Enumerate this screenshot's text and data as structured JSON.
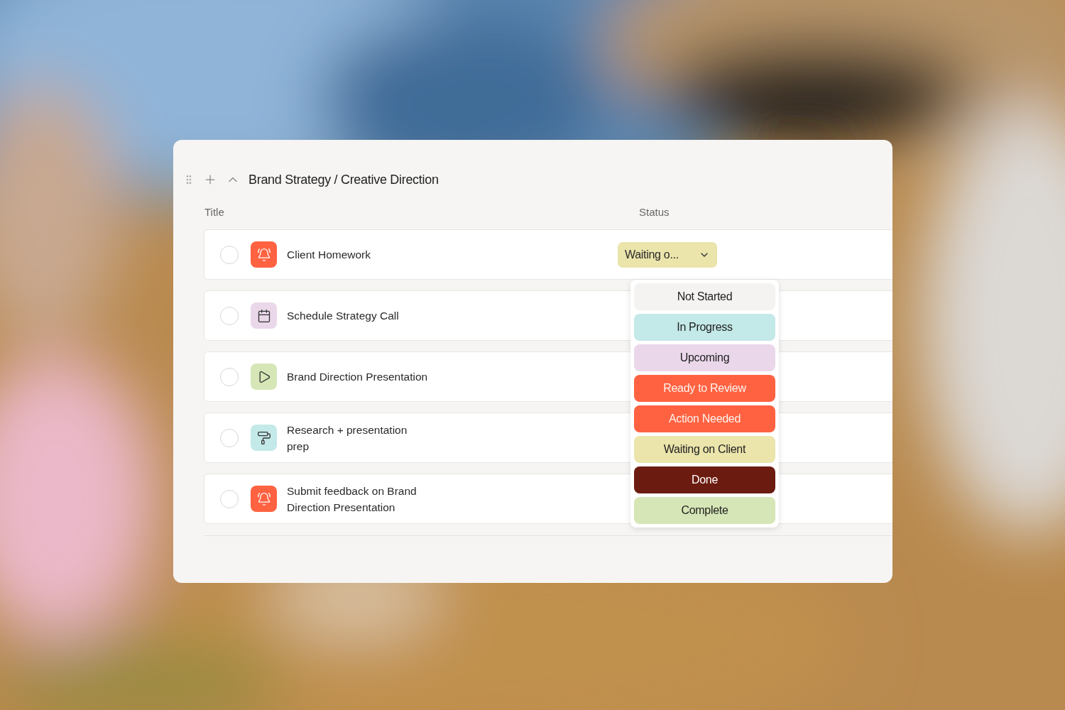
{
  "group": {
    "title": "Brand Strategy / Creative Direction",
    "expanded": true
  },
  "columns": [
    "Title",
    "Status"
  ],
  "tasks": [
    {
      "title": "Client Homework",
      "kind": "alarm",
      "color": "#ff6241",
      "checked": false,
      "status": {
        "label": "Waiting o...",
        "color": "#ebe4ab"
      }
    },
    {
      "title": "Schedule Strategy Call",
      "kind": "calendar",
      "color": "#ead8ea",
      "checked": false
    },
    {
      "title": "Brand Direction Presentation",
      "kind": "play",
      "color": "#d6e6b6",
      "checked": false
    },
    {
      "title": "Research + presentation prep",
      "kind": "roller",
      "color": "#c3e9e8",
      "checked": false
    },
    {
      "title": "Submit feedback on Brand Direction Presentation",
      "kind": "alarm",
      "color": "#ff6241",
      "checked": false
    }
  ],
  "status_menu": [
    {
      "label": "Not Started",
      "color": "#f4f3f1"
    },
    {
      "label": "In Progress",
      "color": "#c3e9e8"
    },
    {
      "label": "Upcoming",
      "color": "#ead8ea"
    },
    {
      "label": "Ready to Review",
      "color": "#ff6241"
    },
    {
      "label": "Action Needed",
      "color": "#ff6241"
    },
    {
      "label": "Waiting on Client",
      "color": "#ebe4ab"
    },
    {
      "label": "Done",
      "color": "#6b1b10"
    },
    {
      "label": "Complete",
      "color": "#d6e6b6"
    }
  ]
}
